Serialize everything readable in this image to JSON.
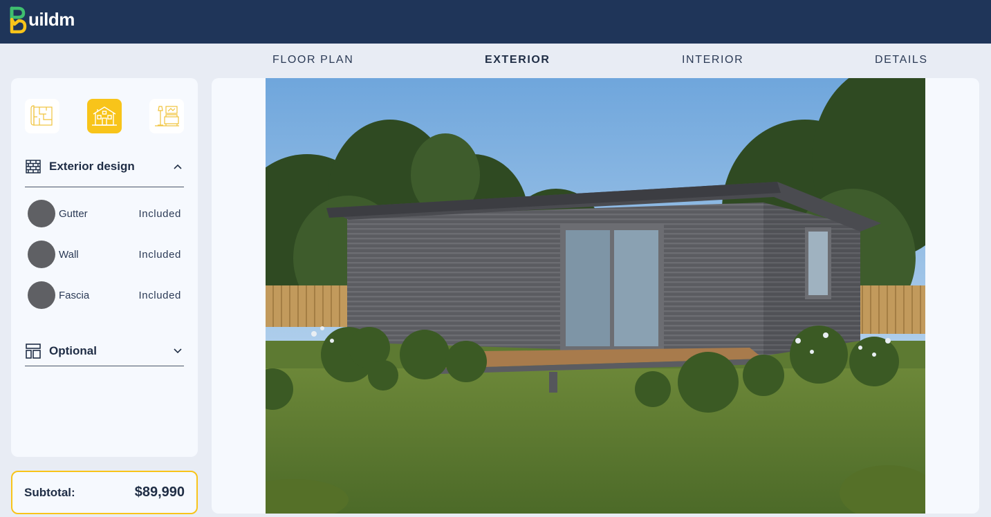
{
  "header": {
    "logo_text": "uildm",
    "logo_letter": "B",
    "brand_colors": {
      "navy": "#1f3559",
      "green": "#3fbf6f",
      "yellow": "#f8c41a"
    }
  },
  "tabs": [
    {
      "label": "FLOOR PLAN",
      "active": false
    },
    {
      "label": "EXTERIOR",
      "active": true
    },
    {
      "label": "INTERIOR",
      "active": false
    },
    {
      "label": "DETAILS",
      "active": false
    }
  ],
  "sidebar": {
    "modes": [
      {
        "icon": "floor-plan-icon",
        "active": false
      },
      {
        "icon": "house-exterior-icon",
        "active": true
      },
      {
        "icon": "interior-room-icon",
        "active": false
      }
    ],
    "exterior_section": {
      "title": "Exterior design",
      "icon": "brick-wall-icon",
      "expanded": true,
      "options": [
        {
          "label": "Gutter",
          "status": "Included",
          "color": "#5f6064"
        },
        {
          "label": "Wall",
          "status": "Included",
          "color": "#5f6064"
        },
        {
          "label": "Fascia",
          "status": "Included",
          "color": "#5f6064"
        }
      ]
    },
    "optional_section": {
      "title": "Optional",
      "icon": "layout-icon",
      "expanded": false
    }
  },
  "subtotal": {
    "label": "Subtotal:",
    "value": "$89,990"
  },
  "viewer": {
    "image": "exterior-render-grey-cladding-cabin"
  },
  "accent_colors": {
    "selected_mode": "#f8c41a",
    "subtotal_border": "#f8c41a",
    "swatch": "#5f6064"
  }
}
